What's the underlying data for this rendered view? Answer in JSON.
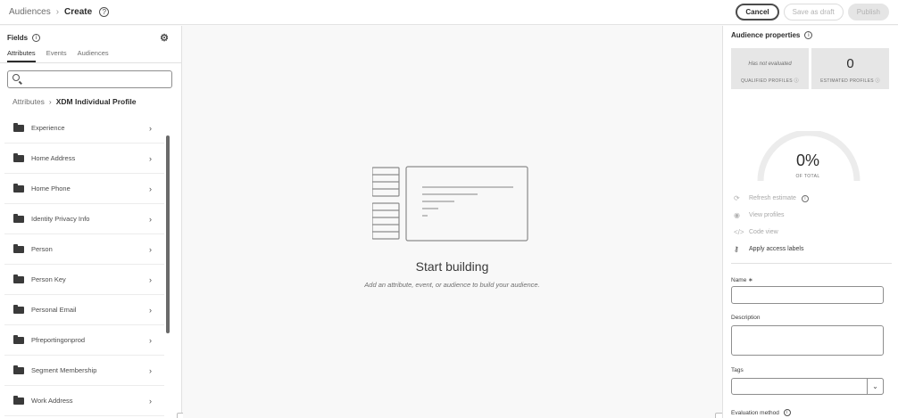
{
  "header": {
    "breadcrumb_root": "Audiences",
    "breadcrumb_sep": "›",
    "breadcrumb_current": "Create",
    "help_icon": "?",
    "cancel_label": "Cancel",
    "save_draft_label": "Save as draft",
    "publish_label": "Publish"
  },
  "left_panel": {
    "title": "Fields",
    "info_icon": "i",
    "tabs": [
      "Attributes",
      "Events",
      "Audiences"
    ],
    "active_tab": "Attributes",
    "search": {
      "value": "",
      "placeholder": ""
    },
    "path_root": "Attributes",
    "path_sep": "›",
    "path_current": "XDM Individual Profile",
    "items": [
      {
        "label": "Experience"
      },
      {
        "label": "Home Address"
      },
      {
        "label": "Home Phone"
      },
      {
        "label": "Identity Privacy Info"
      },
      {
        "label": "Person"
      },
      {
        "label": "Person Key"
      },
      {
        "label": "Personal Email"
      },
      {
        "label": "Pfreportingonprod"
      },
      {
        "label": "Segment Membership"
      },
      {
        "label": "Work Address"
      }
    ],
    "chevron": "›"
  },
  "canvas": {
    "title": "Start building",
    "subtitle": "Add an attribute, event, or audience to build your audience."
  },
  "right_panel": {
    "title": "Audience properties",
    "info_icon": "i",
    "qualified": {
      "value": "Has not evaluated",
      "label": "QUALIFIED PROFILES"
    },
    "estimated": {
      "value": "0",
      "label": "ESTIMATED PROFILES"
    },
    "gauge": {
      "percent": "0%",
      "label": "OF TOTAL",
      "fill": 0
    },
    "actions": {
      "refresh": "Refresh estimate",
      "view_profiles": "View profiles",
      "code_view": "Code view",
      "apply_labels": "Apply access labels"
    },
    "name_label": "Name ∗",
    "name_value": "",
    "description_label": "Description",
    "description_value": "",
    "tags_label": "Tags",
    "tags_value": "",
    "evaluation_label": "Evaluation method"
  }
}
